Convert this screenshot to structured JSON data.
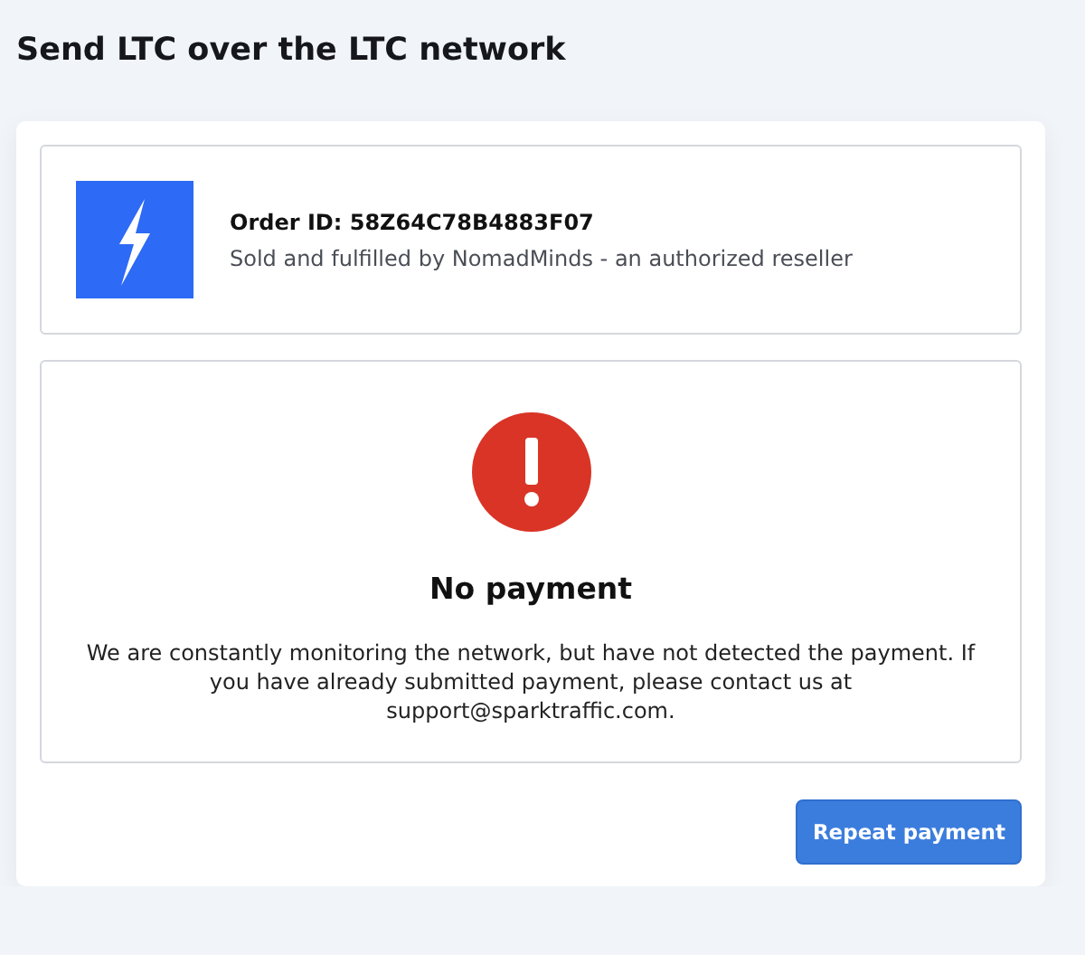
{
  "page_title": "Send LTC over the LTC network",
  "order": {
    "id_label": "Order ID: 58Z64C78B4883F07",
    "seller": "Sold and fulfilled by NomadMinds - an authorized reseller"
  },
  "status": {
    "kind": "error",
    "heading": "No payment",
    "message": "We are constantly monitoring the network, but have not detected the payment. If you have already submitted payment, please contact us at support@sparktraffic.com."
  },
  "buttons": [
    "Repeat payment"
  ]
}
